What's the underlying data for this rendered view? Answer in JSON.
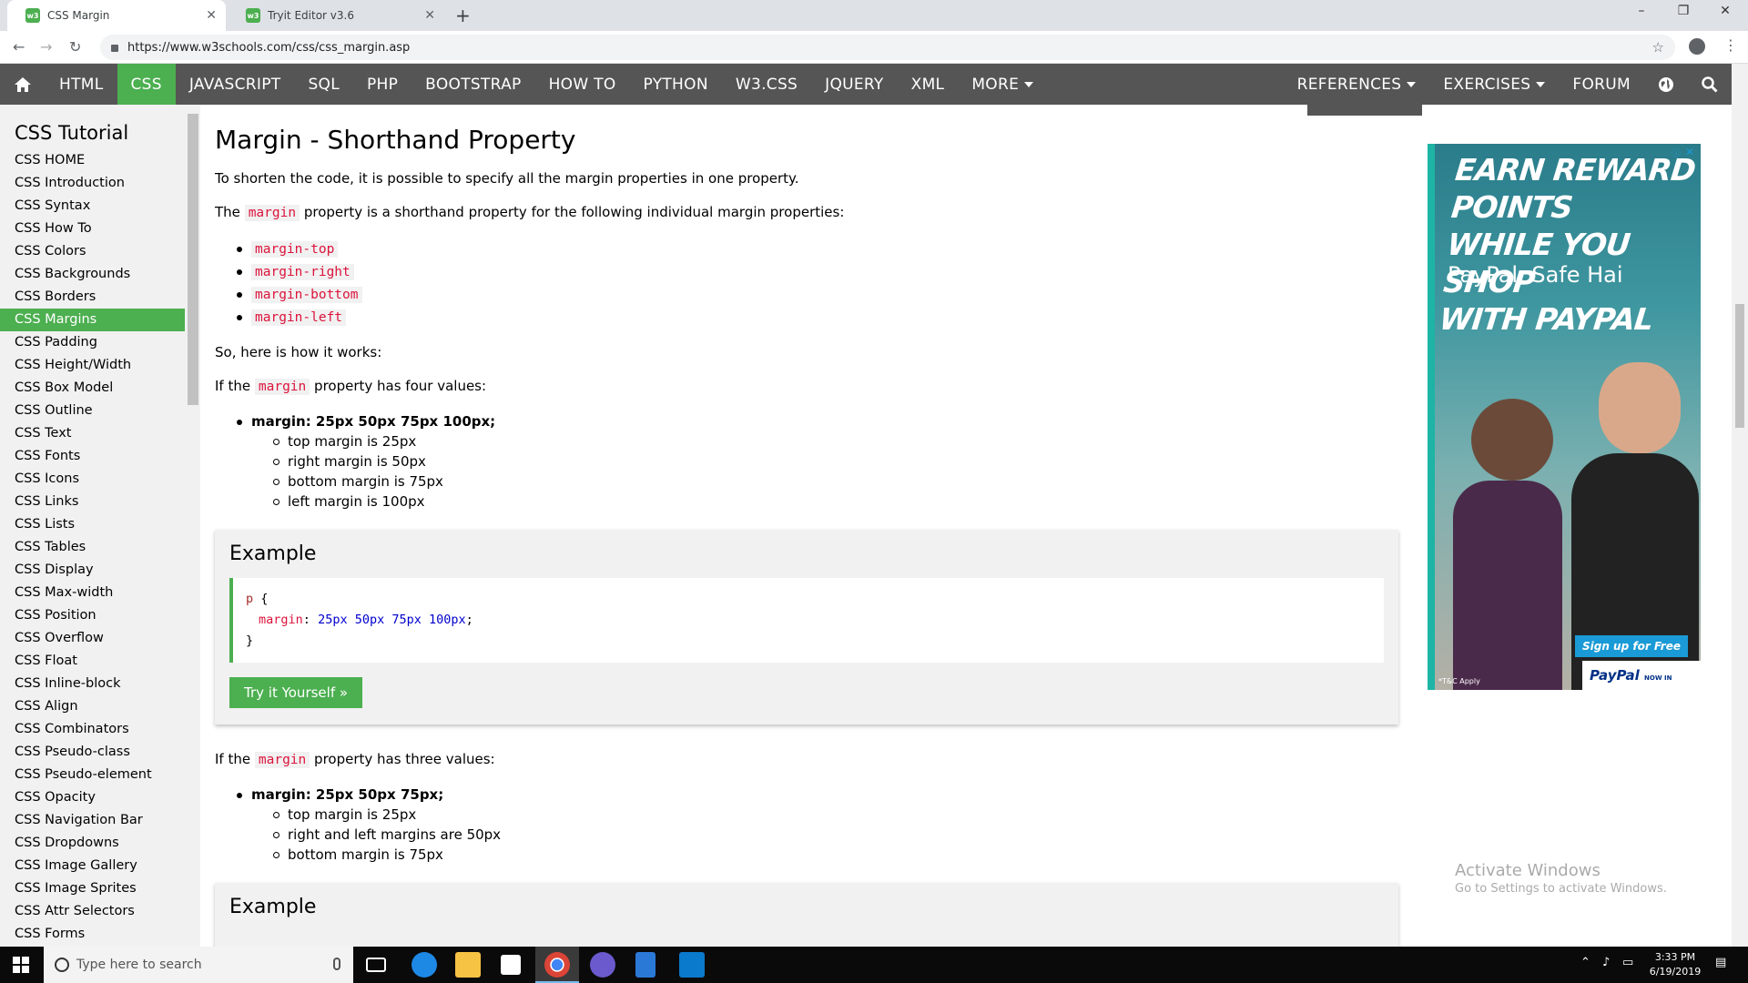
{
  "browser": {
    "tabs": [
      {
        "label": "CSS Margin",
        "favicon": "w3"
      },
      {
        "label": "Tryit Editor v3.6",
        "favicon": "w3"
      }
    ],
    "new_tab_label": "+",
    "url": "https://www.w3schools.com/css/css_margin.asp",
    "window_controls": {
      "minimize": "–",
      "maximize": "❐",
      "close": "✕"
    }
  },
  "topnav": {
    "left_items": [
      "HTML",
      "CSS",
      "JAVASCRIPT",
      "SQL",
      "PHP",
      "BOOTSTRAP",
      "HOW TO",
      "PYTHON",
      "W3.CSS",
      "JQUERY",
      "XML",
      "MORE"
    ],
    "active_item": "CSS",
    "right_items": [
      "REFERENCES",
      "EXERCISES",
      "FORUM"
    ],
    "accent": "#4caf50",
    "bar_color": "#555555"
  },
  "sidebar": {
    "heading": "CSS Tutorial",
    "items": [
      "CSS HOME",
      "CSS Introduction",
      "CSS Syntax",
      "CSS How To",
      "CSS Colors",
      "CSS Backgrounds",
      "CSS Borders",
      "CSS Margins",
      "CSS Padding",
      "CSS Height/Width",
      "CSS Box Model",
      "CSS Outline",
      "CSS Text",
      "CSS Fonts",
      "CSS Icons",
      "CSS Links",
      "CSS Lists",
      "CSS Tables",
      "CSS Display",
      "CSS Max-width",
      "CSS Position",
      "CSS Overflow",
      "CSS Float",
      "CSS Inline-block",
      "CSS Align",
      "CSS Combinators",
      "CSS Pseudo-class",
      "CSS Pseudo-element",
      "CSS Opacity",
      "CSS Navigation Bar",
      "CSS Dropdowns",
      "CSS Image Gallery",
      "CSS Image Sprites",
      "CSS Attr Selectors",
      "CSS Forms"
    ],
    "active_item": "CSS Margins"
  },
  "main": {
    "title": "Margin - Shorthand Property",
    "intro": "To shorten the code, it is possible to specify all the margin properties in one property.",
    "shorthand_pre": "The",
    "shorthand_code": "margin",
    "shorthand_post": "property is a shorthand property for the following individual margin properties:",
    "properties": [
      "margin-top",
      "margin-right",
      "margin-bottom",
      "margin-left"
    ],
    "how_it_works": "So, here is how it works:",
    "four": {
      "pre": "If the",
      "code": "margin",
      "post": "property has four values:",
      "head": "margin: 25px 50px 75px 100px;",
      "items": [
        "top margin is 25px",
        "right margin is 50px",
        "bottom margin is 75px",
        "left margin is 100px"
      ]
    },
    "example1": {
      "heading": "Example",
      "selector": "p",
      "open": "{",
      "prop": "margin",
      "colon": ":",
      "value": "25px 50px 75px 100px",
      "semi": ";",
      "close": "}",
      "button": "Try it Yourself »"
    },
    "three": {
      "pre": "If the",
      "code": "margin",
      "post": "property has three values:",
      "head": "margin: 25px 50px 75px;",
      "items": [
        "top margin is 25px",
        "right and left margins are 50px",
        "bottom margin is 75px"
      ]
    },
    "example2": {
      "heading": "Example"
    }
  },
  "ad": {
    "headline": [
      "EARN REWARD POINTS",
      "WHILE YOU SHOP",
      "WITH PAYPAL"
    ],
    "tagline": "PayPal, Safe Hai",
    "signup": "Sign up for Free",
    "brand": "PayPal",
    "brand_sub": "NOW IN INDIA",
    "tc": "*T&C Apply"
  },
  "watermark": {
    "line1": "Activate Windows",
    "line2": "Go to Settings to activate Windows."
  },
  "taskbar": {
    "search_placeholder": "Type here to search",
    "time": "3:33 PM",
    "date": "6/19/2019"
  }
}
